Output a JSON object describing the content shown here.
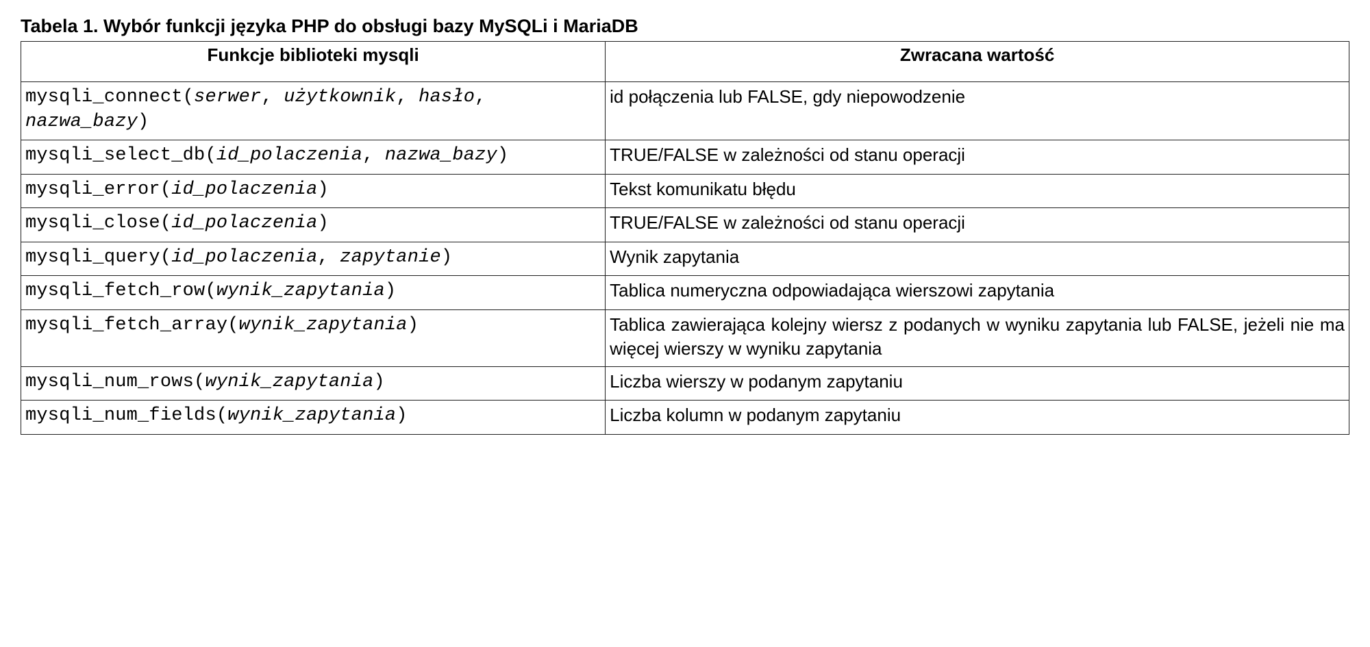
{
  "caption": "Tabela 1. Wybór funkcji języka PHP do obsługi bazy MySQLi i MariaDB",
  "headers": {
    "col1": "Funkcje biblioteki mysqli",
    "col2": "Zwracana wartość"
  },
  "rows": [
    {
      "fn": {
        "segments": [
          {
            "t": "mysqli_connect(",
            "i": false
          },
          {
            "t": "serwer",
            "i": true
          },
          {
            "t": ", ",
            "i": false
          },
          {
            "t": "użytkownik",
            "i": true
          },
          {
            "t": ", ",
            "i": false
          },
          {
            "t": "hasło",
            "i": true
          },
          {
            "t": ", ",
            "i": false
          },
          {
            "t": "nazwa_bazy",
            "i": true
          },
          {
            "t": ")",
            "i": false
          }
        ]
      },
      "val": "id połączenia lub FALSE, gdy niepowodzenie",
      "justify": false
    },
    {
      "fn": {
        "segments": [
          {
            "t": "mysqli_select_db(",
            "i": false
          },
          {
            "t": "id_polaczenia",
            "i": true
          },
          {
            "t": ", ",
            "i": false
          },
          {
            "t": "nazwa_bazy",
            "i": true
          },
          {
            "t": ")",
            "i": false
          }
        ]
      },
      "val": "TRUE/FALSE w zależności od stanu operacji",
      "justify": false
    },
    {
      "fn": {
        "segments": [
          {
            "t": "mysqli_error(",
            "i": false
          },
          {
            "t": "id_polaczenia",
            "i": true
          },
          {
            "t": ")",
            "i": false
          }
        ]
      },
      "val": "Tekst komunikatu błędu",
      "justify": false
    },
    {
      "fn": {
        "segments": [
          {
            "t": "mysqli_close(",
            "i": false
          },
          {
            "t": "id_polaczenia",
            "i": true
          },
          {
            "t": ")",
            "i": false
          }
        ]
      },
      "val": "TRUE/FALSE w zależności od stanu operacji",
      "justify": false
    },
    {
      "fn": {
        "segments": [
          {
            "t": "mysqli_query(",
            "i": false
          },
          {
            "t": "id_polaczenia",
            "i": true
          },
          {
            "t": ", ",
            "i": false
          },
          {
            "t": "zapytanie",
            "i": true
          },
          {
            "t": ")",
            "i": false
          }
        ]
      },
      "val": "Wynik zapytania",
      "justify": false
    },
    {
      "fn": {
        "segments": [
          {
            "t": "mysqli_fetch_row(",
            "i": false
          },
          {
            "t": "wynik_zapytania",
            "i": true
          },
          {
            "t": ")",
            "i": false
          }
        ]
      },
      "val": "Tablica numeryczna odpowiadająca wierszowi zapytania",
      "justify": true
    },
    {
      "fn": {
        "segments": [
          {
            "t": "mysqli_fetch_array(",
            "i": false
          },
          {
            "t": "wynik_zapytania",
            "i": true
          },
          {
            "t": ")",
            "i": false
          }
        ]
      },
      "val": "Tablica zawierająca kolejny wiersz z podanych w wyniku zapytania lub FALSE, jeżeli nie ma więcej wierszy w wyniku zapytania",
      "justify": true
    },
    {
      "fn": {
        "segments": [
          {
            "t": "mysqli_num_rows(",
            "i": false
          },
          {
            "t": "wynik_zapytania",
            "i": true
          },
          {
            "t": ")",
            "i": false
          }
        ]
      },
      "val": "Liczba wierszy w podanym zapytaniu",
      "justify": false
    },
    {
      "fn": {
        "segments": [
          {
            "t": "mysqli_num_fields(",
            "i": false
          },
          {
            "t": "wynik_zapytania",
            "i": true
          },
          {
            "t": ")",
            "i": false
          }
        ]
      },
      "val": "Liczba kolumn w podanym zapytaniu",
      "justify": false
    }
  ]
}
